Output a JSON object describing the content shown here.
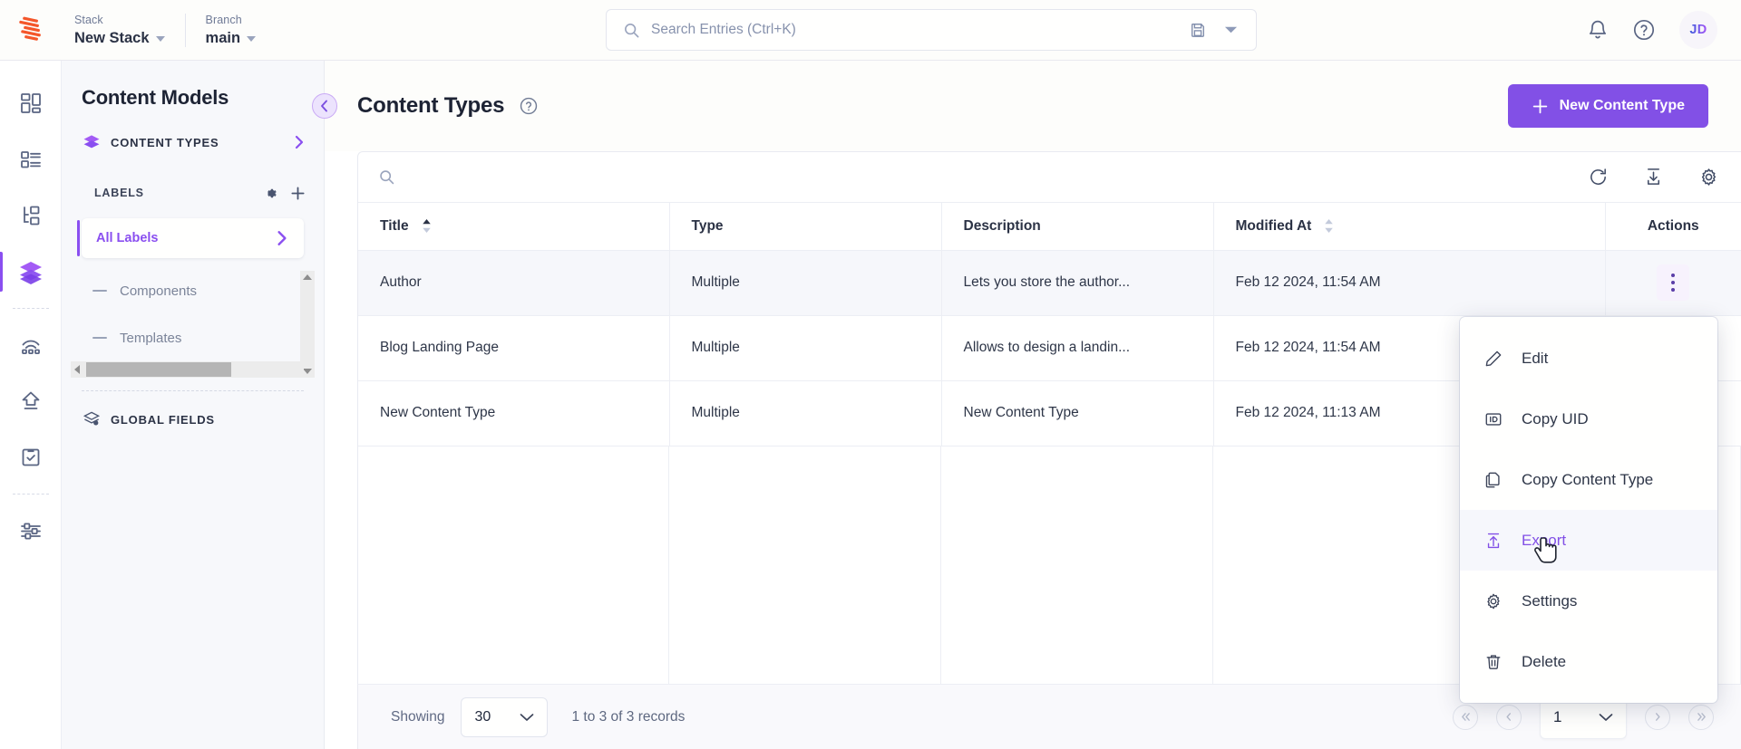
{
  "topbar": {
    "logo_icon": "contentstack-logo-icon",
    "stack": {
      "label": "Stack",
      "value": "New Stack",
      "caret_icon": "caret-down-icon"
    },
    "branch": {
      "label": "Branch",
      "value": "main",
      "caret_icon": "caret-down-icon"
    },
    "search": {
      "icon": "search-icon",
      "placeholder": "Search Entries (Ctrl+K)",
      "save_icon": "save-disk-icon",
      "dropdown_icon": "caret-down-icon"
    },
    "notifications_icon": "bell-icon",
    "help_icon": "help-circle-icon",
    "avatar": {
      "initials": "JD",
      "name": "user-avatar"
    }
  },
  "rail": {
    "items": [
      {
        "name": "sidebar-item-dashboard",
        "icon": "dashboard-grid-icon",
        "active": false
      },
      {
        "name": "sidebar-item-entries",
        "icon": "list-view-icon",
        "active": false
      },
      {
        "name": "sidebar-item-hierarchy",
        "icon": "hierarchy-tree-icon",
        "active": false
      },
      {
        "name": "sidebar-item-content-models",
        "icon": "stacked-layers-icon",
        "active": true
      },
      {
        "name": "sidebar-item-live-preview",
        "icon": "broadcast-icon",
        "active": false
      },
      {
        "name": "sidebar-item-releases",
        "icon": "upload-arrow-icon",
        "active": false
      },
      {
        "name": "sidebar-item-workflows",
        "icon": "clipboard-check-icon",
        "active": false
      },
      {
        "name": "sidebar-item-settings",
        "icon": "sliders-settings-icon",
        "active": false
      }
    ]
  },
  "content_models": {
    "title": "Content Models",
    "content_types": {
      "label": "CONTENT TYPES",
      "icon": "stacked-layers-icon",
      "chevron": "chevron-right-icon"
    },
    "labels_section": {
      "label": "LABELS",
      "gear_icon": "gear-icon",
      "add_icon": "plus-icon"
    },
    "all_labels": {
      "label": "All Labels",
      "chevron": "chevron-right-icon"
    },
    "tree_items": [
      {
        "label": "Components",
        "icon": "minus-icon"
      },
      {
        "label": "Templates",
        "icon": "minus-icon"
      }
    ],
    "global_fields": {
      "label": "GLOBAL FIELDS",
      "icon": "global-fields-icon"
    }
  },
  "main_header": {
    "collapse_icon": "chevron-left-icon",
    "title": "Content Types",
    "help_icon": "help-circle-icon",
    "new_button": {
      "label": "New Content Type",
      "icon": "plus-icon"
    }
  },
  "table_toolbar": {
    "search_icon": "search-icon",
    "refresh_icon": "refresh-icon",
    "import_icon": "download-import-icon",
    "settings_icon": "gear-icon"
  },
  "table": {
    "columns": [
      {
        "label": "Title",
        "sort_icon": "sort-arrows-icon",
        "sorted": "asc"
      },
      {
        "label": "Type",
        "sort_icon": null,
        "sorted": null
      },
      {
        "label": "Description",
        "sort_icon": null,
        "sorted": null
      },
      {
        "label": "Modified At",
        "sort_icon": "sort-arrows-icon",
        "sorted": null
      },
      {
        "label": "Actions",
        "sort_icon": null,
        "sorted": null
      }
    ],
    "rows": [
      {
        "title": "Author",
        "type": "Multiple",
        "description": "Lets you store the author...",
        "modified_at": "Feb 12 2024, 11:54 AM",
        "actions_icon": "kebab-menu-icon",
        "hovered": true
      },
      {
        "title": "Blog Landing Page",
        "type": "Multiple",
        "description": "Allows to design a landin...",
        "modified_at": "Feb 12 2024, 11:54 AM",
        "actions_icon": "kebab-menu-icon",
        "hovered": false
      },
      {
        "title": "New Content Type",
        "type": "Multiple",
        "description": "New Content Type",
        "modified_at": "Feb 12 2024, 11:13 AM",
        "actions_icon": "kebab-menu-icon",
        "hovered": false
      }
    ]
  },
  "context_menu": {
    "items": [
      {
        "label": "Edit",
        "icon": "pencil-icon",
        "highlighted": false
      },
      {
        "label": "Copy UID",
        "icon": "id-badge-icon",
        "highlighted": false
      },
      {
        "label": "Copy Content Type",
        "icon": "copy-pages-icon",
        "highlighted": false
      },
      {
        "label": "Export",
        "icon": "export-upload-icon",
        "highlighted": true
      },
      {
        "label": "Settings",
        "icon": "gear-icon",
        "highlighted": false
      },
      {
        "label": "Delete",
        "icon": "trash-icon",
        "highlighted": false
      }
    ]
  },
  "footer": {
    "showing_label": "Showing",
    "per_page": "30",
    "per_page_caret": "chevron-down-icon",
    "records_text": "1 to 3 of 3 records",
    "pagination": {
      "first_icon": "double-chevron-left-icon",
      "prev_icon": "chevron-left-icon",
      "page": "1",
      "page_caret": "chevron-down-icon",
      "next_icon": "chevron-right-icon",
      "last_icon": "double-chevron-right-icon"
    }
  },
  "colors": {
    "accent_purple": "#8250e6",
    "active_rail": "#8a4ff0",
    "text_dark": "#1d2334",
    "text_muted": "#6f7a96",
    "logo_orange": "#f4562a"
  }
}
